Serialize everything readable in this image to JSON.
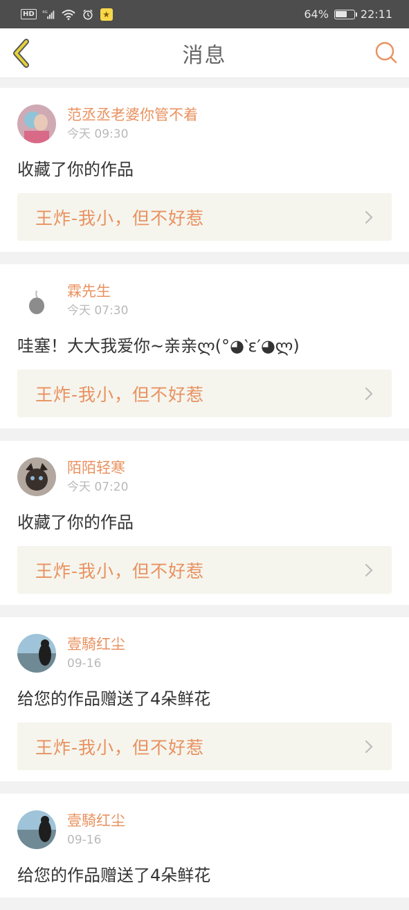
{
  "status_bar": {
    "hd": "HD",
    "network": "4G",
    "battery_percent_text": "64%",
    "battery_level": 0.64,
    "time": "22:11"
  },
  "header": {
    "title": "消息",
    "back_icon": "chevron-left-icon",
    "search_icon": "search-icon"
  },
  "colors": {
    "accent": "#e9915f",
    "back_icon": "#e6d23a",
    "status_bar_bg": "#4d4d4d",
    "link_bg": "#f5f5ee"
  },
  "messages": [
    {
      "user": "范丞丞老婆你管不着",
      "time": "今天 09:30",
      "text": "收藏了你的作品",
      "work": "王炸-我小，但不好惹"
    },
    {
      "user": "霖先生",
      "time": "今天 07:30",
      "text": "哇塞！大大我爱你~亲亲ლ(°◕‵ε′◕ლ)",
      "work": "王炸-我小，但不好惹"
    },
    {
      "user": "陌陌轻寒",
      "time": "今天 07:20",
      "text": "收藏了你的作品",
      "work": "王炸-我小，但不好惹"
    },
    {
      "user": "壹騎红尘",
      "time": "09-16",
      "text": "给您的作品赠送了4朵鲜花",
      "work": "王炸-我小，但不好惹"
    },
    {
      "user": "壹騎红尘",
      "time": "09-16",
      "text": "给您的作品赠送了4朵鲜花",
      "work": ""
    }
  ]
}
